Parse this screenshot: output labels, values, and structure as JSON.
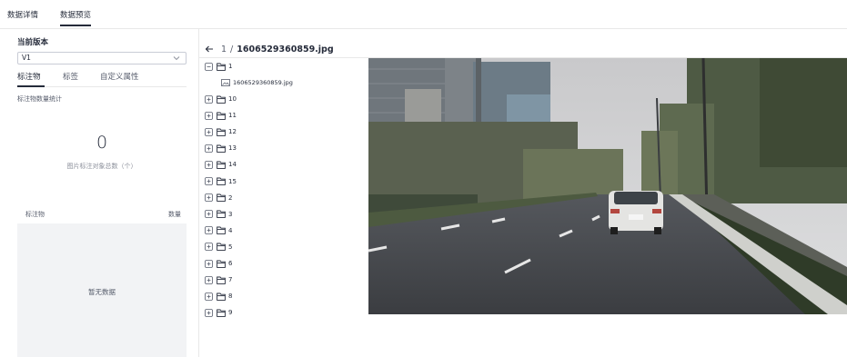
{
  "top_tabs": {
    "details": "数据详情",
    "preview": "数据预览"
  },
  "left": {
    "version_title": "当前版本",
    "version_value": "V1",
    "sub_tabs": [
      "标注物",
      "标签",
      "自定义属性"
    ],
    "stats_title": "标注物数量统计",
    "count": "0",
    "count_label": "图片标注对象总数（个）",
    "table_headers": [
      "标注物",
      "数量"
    ],
    "empty_text": "暂无数据"
  },
  "viewer": {
    "index": "1",
    "separator": "/",
    "file_name": "1606529360859.jpg"
  },
  "tree": {
    "expanded_folder": "1",
    "file": "1606529360859.jpg",
    "folders": [
      "10",
      "11",
      "12",
      "13",
      "14",
      "15",
      "2",
      "3",
      "4",
      "5",
      "6",
      "7",
      "8",
      "9"
    ]
  },
  "colors": {
    "text_primary": "#252b3a",
    "text_secondary": "#575d6c",
    "border": "#e8e8e8",
    "empty_bg": "#f2f3f5"
  }
}
